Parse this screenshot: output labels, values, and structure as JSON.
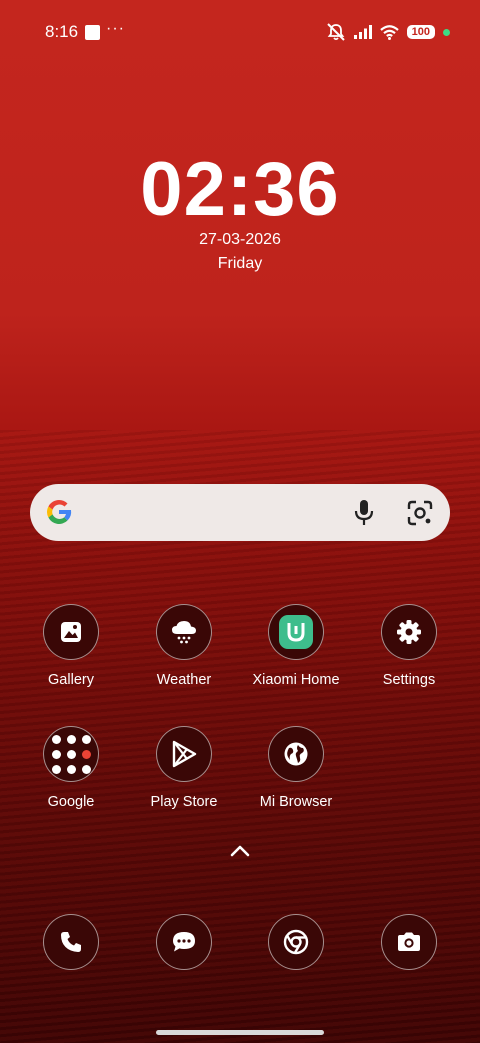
{
  "status_bar": {
    "time": "8:16",
    "more": "···",
    "battery": "100",
    "icons": [
      "notifications-off-icon",
      "signal-icon",
      "wifi-icon",
      "battery-icon",
      "green-dot-indicator"
    ]
  },
  "clock": {
    "time": "02:36",
    "date": "27-03-2026",
    "day": "Friday"
  },
  "search": {
    "icons": [
      "google-g-logo",
      "microphone-icon",
      "google-lens-icon"
    ]
  },
  "apps": [
    {
      "label": "Gallery",
      "icon": "gallery-icon"
    },
    {
      "label": "Weather",
      "icon": "weather-icon"
    },
    {
      "label": "Xiaomi Home",
      "icon": "xiaomi-home-icon"
    },
    {
      "label": "Settings",
      "icon": "gear-icon"
    },
    {
      "label": "Google",
      "icon": "folder-icon"
    },
    {
      "label": "Play Store",
      "icon": "play-store-icon"
    },
    {
      "label": "Mi Browser",
      "icon": "globe-icon"
    }
  ],
  "dock": [
    "phone-icon",
    "messages-icon",
    "chrome-icon",
    "camera-icon"
  ],
  "colors": {
    "wallpaper": "#c4261e",
    "icon_bg": "#3a0706",
    "search_bg": "#efe9e7",
    "xiaomi_green": "#3ebd8c"
  }
}
